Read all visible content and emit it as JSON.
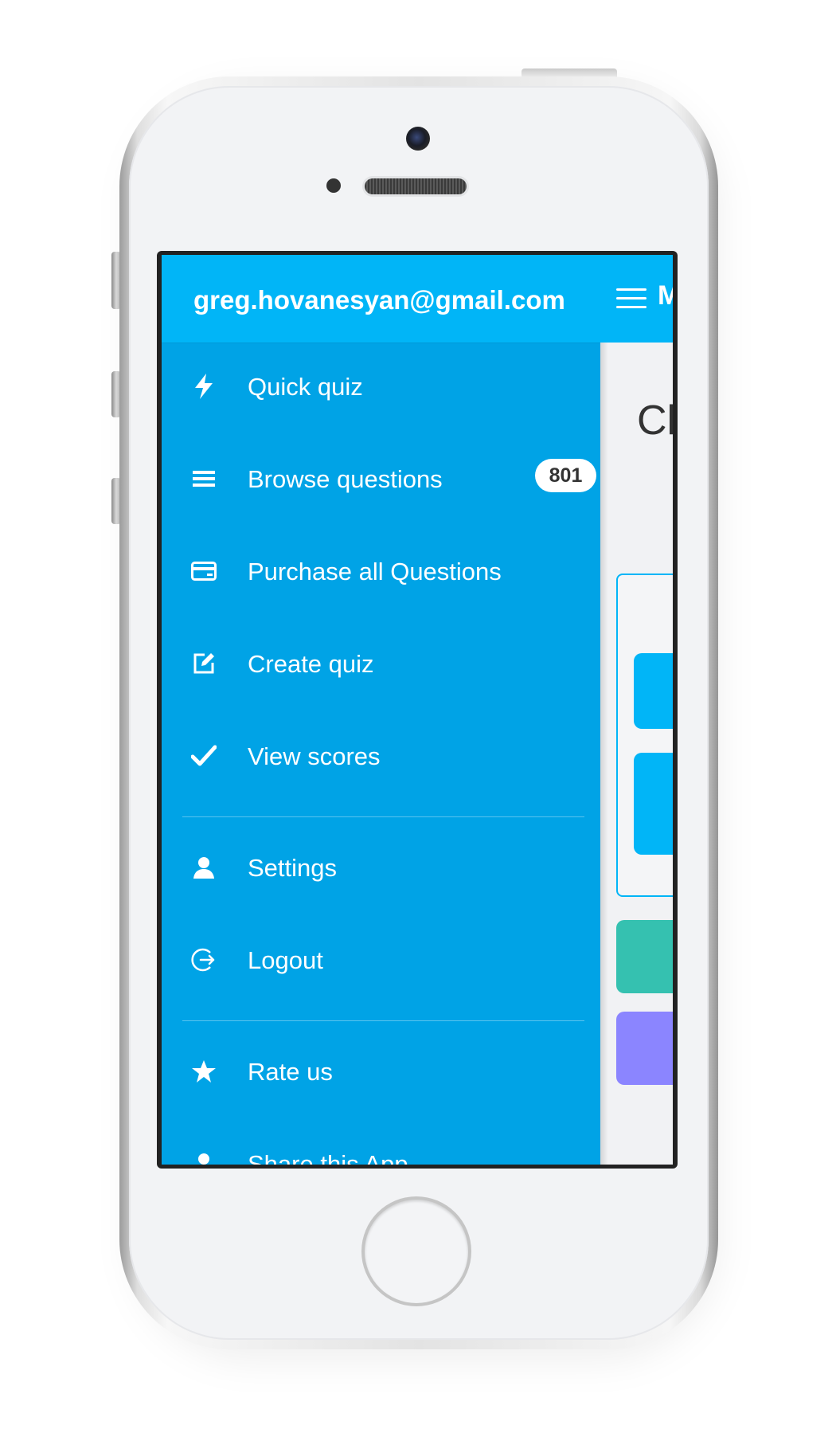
{
  "drawer": {
    "account_email": "greg.hovanesyan@gmail.com",
    "items": [
      {
        "label": "Quick quiz",
        "icon": "lightning-icon"
      },
      {
        "label": "Browse questions",
        "icon": "list-icon",
        "badge": "801"
      },
      {
        "label": "Purchase all Questions",
        "icon": "credit-card-icon"
      },
      {
        "label": "Create quiz",
        "icon": "edit-icon"
      },
      {
        "label": "View scores",
        "icon": "checkmark-icon"
      },
      {
        "label": "Settings",
        "icon": "user-icon"
      },
      {
        "label": "Logout",
        "icon": "logout-icon"
      },
      {
        "label": "Rate us",
        "icon": "star-icon"
      },
      {
        "label": "Share this App",
        "icon": "share-icon"
      }
    ]
  },
  "main": {
    "header_title_fragment": "M",
    "heading_fragment": "Cl"
  },
  "colors": {
    "header_blue": "#01b5f7",
    "drawer_blue": "#00a3e6",
    "button_blue": "#01b5f7",
    "teal": "#35c1b0",
    "purple": "#8b85ff"
  }
}
